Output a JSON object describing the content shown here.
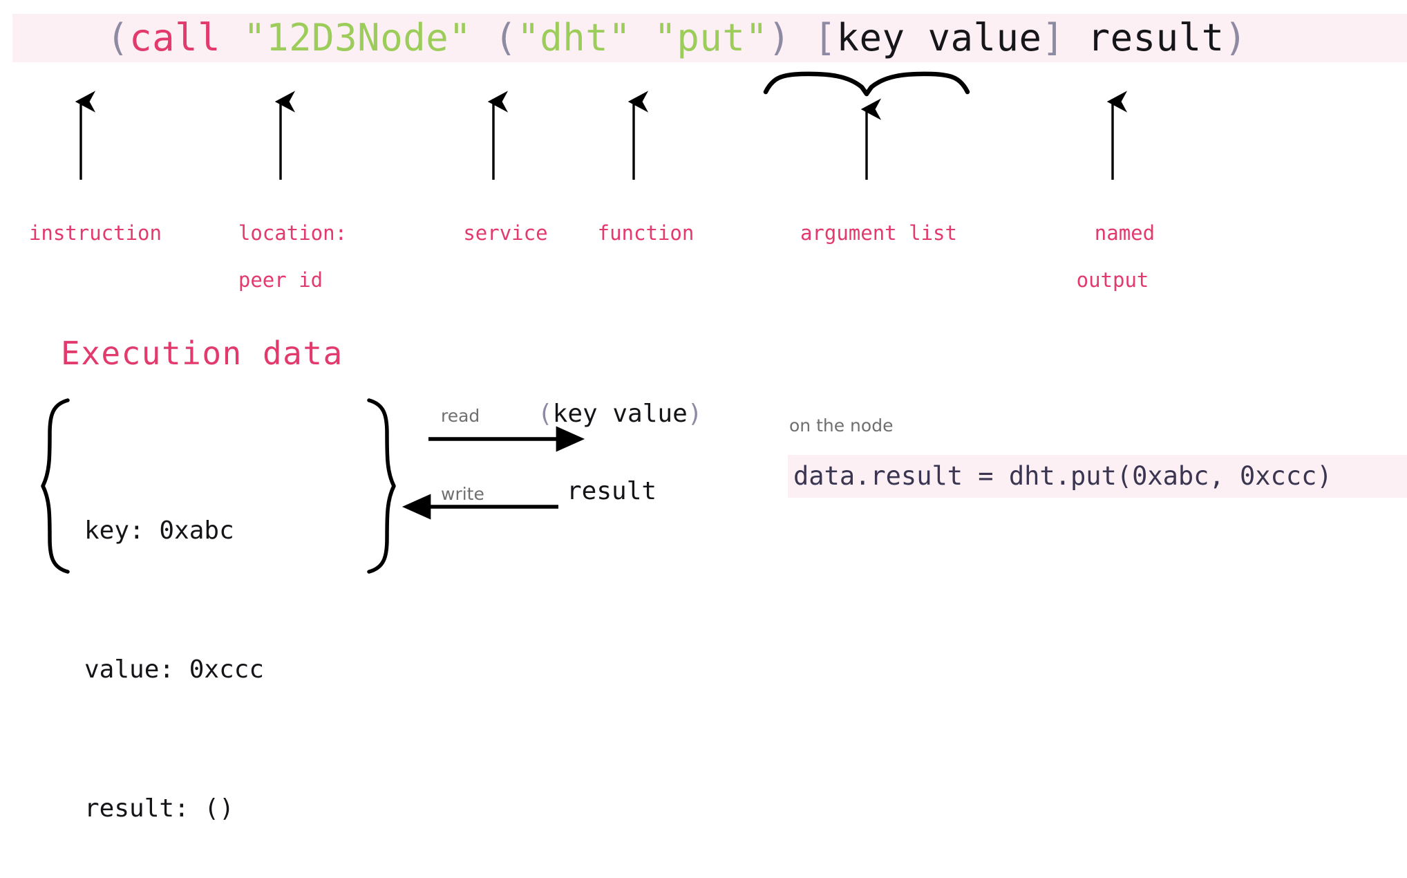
{
  "colors": {
    "code_bg": "#fdf0f4",
    "keyword": "#e23a6d",
    "string": "#9ccc5a",
    "paren": "#8f8aa3",
    "plain": "#16161a",
    "annotation": "#e23a6d",
    "muted": "#6f6f6f",
    "node_code": "#3a3550",
    "page_bg": "#ffffff"
  },
  "top_code": {
    "full_text": "(call \"12D3Node\" (\"dht\" \"put\") [key value] result)",
    "tokens": [
      {
        "text": "(",
        "kind": "paren"
      },
      {
        "text": "call",
        "kind": "kw"
      },
      {
        "text": " ",
        "kind": "plain"
      },
      {
        "text": "\"12D3Node\"",
        "kind": "str"
      },
      {
        "text": " ",
        "kind": "plain"
      },
      {
        "text": "(",
        "kind": "paren"
      },
      {
        "text": "\"dht\"",
        "kind": "str"
      },
      {
        "text": " ",
        "kind": "plain"
      },
      {
        "text": "\"put\"",
        "kind": "str"
      },
      {
        "text": ")",
        "kind": "paren"
      },
      {
        "text": " ",
        "kind": "plain"
      },
      {
        "text": "[",
        "kind": "bracket"
      },
      {
        "text": "key value",
        "kind": "plain"
      },
      {
        "text": "]",
        "kind": "bracket"
      },
      {
        "text": " ",
        "kind": "plain"
      },
      {
        "text": "result",
        "kind": "plain"
      },
      {
        "text": ")",
        "kind": "paren"
      }
    ]
  },
  "annotations": [
    {
      "id": "instruction",
      "line1": "instruction",
      "line2": ""
    },
    {
      "id": "location",
      "line1": "location:",
      "line2": "peer id"
    },
    {
      "id": "service",
      "line1": "service",
      "line2": ""
    },
    {
      "id": "function",
      "line1": "function",
      "line2": ""
    },
    {
      "id": "argument-list",
      "line1": "argument list",
      "line2": ""
    },
    {
      "id": "named-output",
      "line1": "named",
      "line2": "output"
    }
  ],
  "execution_data": {
    "title": "Execution data",
    "rows": [
      {
        "key": "key",
        "text": "key: 0xabc"
      },
      {
        "key": "value",
        "text": "value: 0xccc"
      },
      {
        "key": "result",
        "text": "result: ()"
      }
    ]
  },
  "flows": [
    {
      "id": "read",
      "tag": "read",
      "payload_open": "(",
      "payload_body": "key value",
      "payload_close": ")",
      "payload_text": "(key value)",
      "direction": "right"
    },
    {
      "id": "write",
      "tag": "write",
      "payload_open": "",
      "payload_body": "result",
      "payload_close": "",
      "payload_text": "result",
      "direction": "left"
    }
  ],
  "node_panel": {
    "caption": "on the node",
    "code": "data.result = dht.put(0xabc, 0xccc)"
  }
}
